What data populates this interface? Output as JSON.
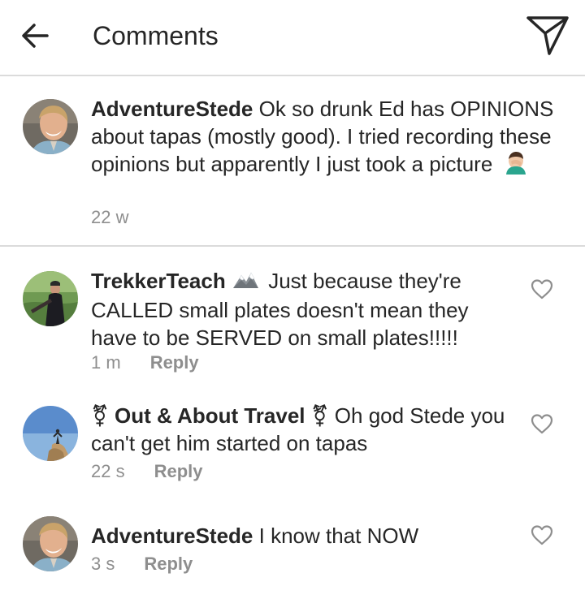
{
  "header": {
    "title": "Comments"
  },
  "caption": {
    "username": "AdventureStede",
    "text": "Ok so drunk Ed has OPINIONS about tapas (mostly good). I tried recording these opinions but apparently I just took a picture",
    "time": "22 w",
    "emoji": "face-palm-emoji"
  },
  "comments": [
    {
      "username": "TrekkerTeach",
      "emoji": "mountain-emoji",
      "text": "Just because they're CALLED small plates doesn't mean they have to be SERVED on small plates!!!!!",
      "time": "1 m",
      "reply_label": "Reply"
    },
    {
      "username_prefix": "⚧",
      "username": "Out & About Travel",
      "username_suffix": "⚧",
      "text": "Oh god Stede you can't get him started on tapas",
      "time": "22 s",
      "reply_label": "Reply"
    },
    {
      "username": "AdventureStede",
      "text": "I know that NOW",
      "time": "3 s",
      "reply_label": "Reply"
    }
  ],
  "colors": {
    "text": "#262626",
    "muted": "#8e8e8e",
    "divider": "#dbdbdb"
  }
}
